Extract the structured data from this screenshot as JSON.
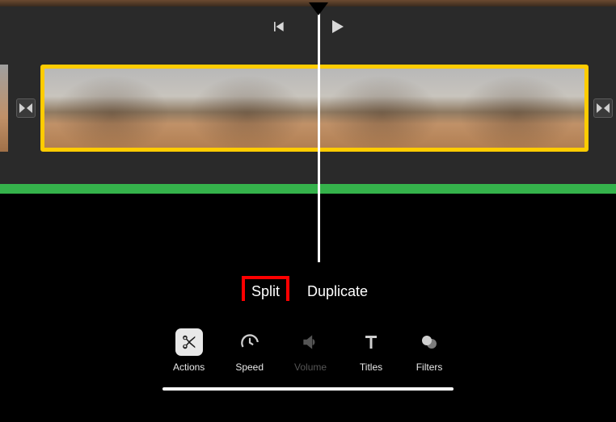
{
  "playback": {
    "prev_icon": "skip-back",
    "play_icon": "play"
  },
  "timeline": {
    "clip_selected": true,
    "audio_track": true
  },
  "actions": {
    "split_label": "Split",
    "duplicate_label": "Duplicate"
  },
  "toolbar": {
    "items": [
      {
        "id": "actions",
        "label": "Actions",
        "icon": "scissors",
        "selected": true,
        "disabled": false
      },
      {
        "id": "speed",
        "label": "Speed",
        "icon": "gauge",
        "selected": false,
        "disabled": false
      },
      {
        "id": "volume",
        "label": "Volume",
        "icon": "speaker",
        "selected": false,
        "disabled": true
      },
      {
        "id": "titles",
        "label": "Titles",
        "icon": "text-T",
        "selected": false,
        "disabled": false
      },
      {
        "id": "filters",
        "label": "Filters",
        "icon": "circles",
        "selected": false,
        "disabled": false
      }
    ]
  }
}
